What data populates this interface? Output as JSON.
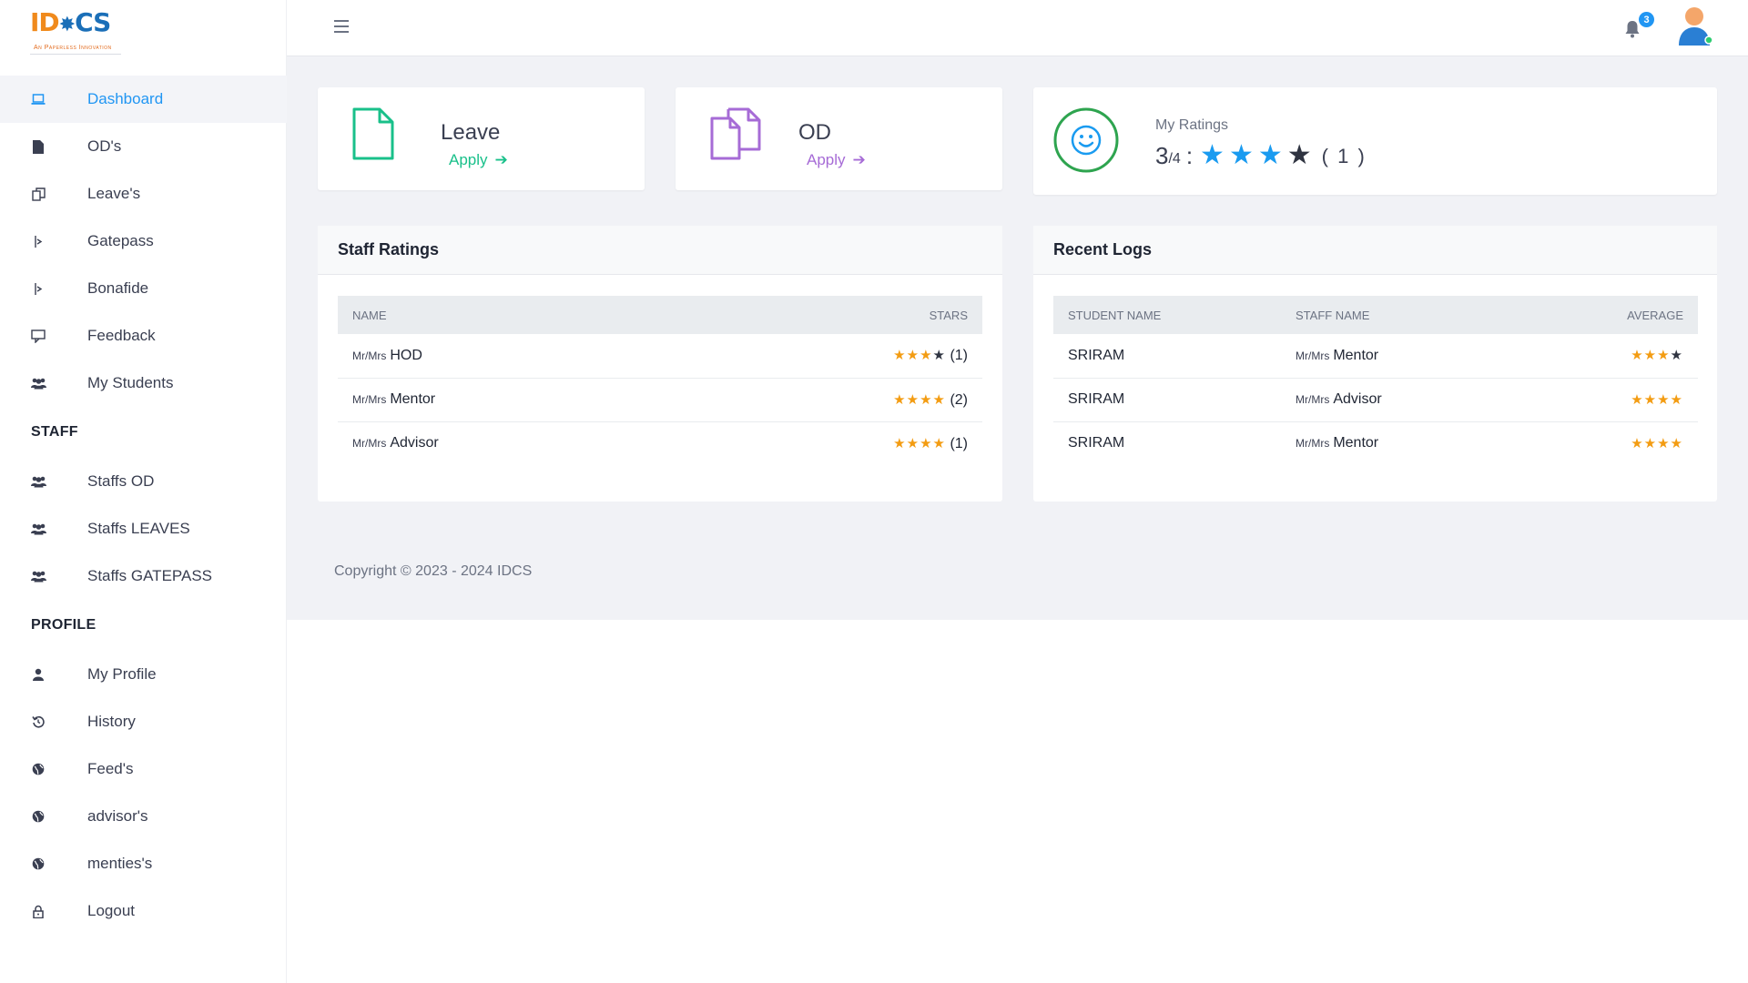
{
  "brand": {
    "logo_id": "ID",
    "logo_cs": "CS",
    "tagline": "An Paperless Innovation"
  },
  "colors": {
    "accent": "#2196f3",
    "leave": "#19c08a",
    "od": "#a66bd6",
    "star_orange": "#f39c12",
    "star_blue": "#1a9bf0",
    "ratings_ring": "#2ea44f"
  },
  "sidebar": {
    "main_items": [
      {
        "label": "Dashboard",
        "icon": "laptop-icon",
        "active": true
      },
      {
        "label": "OD's",
        "icon": "file-icon"
      },
      {
        "label": "Leave's",
        "icon": "copy-icon"
      },
      {
        "label": "Gatepass",
        "icon": "gate-icon"
      },
      {
        "label": "Bonafide",
        "icon": "gate-icon"
      },
      {
        "label": "Feedback",
        "icon": "comment-icon"
      },
      {
        "label": "My Students",
        "icon": "users-icon"
      }
    ],
    "staff_heading": "STAFF",
    "staff_items": [
      {
        "label": "Staffs OD",
        "icon": "users-icon"
      },
      {
        "label": "Staffs LEAVES",
        "icon": "users-icon"
      },
      {
        "label": "Staffs GATEPASS",
        "icon": "users-icon"
      }
    ],
    "profile_heading": "PROFILE",
    "profile_items": [
      {
        "label": "My Profile",
        "icon": "user-icon"
      },
      {
        "label": "History",
        "icon": "history-icon"
      },
      {
        "label": "Feed's",
        "icon": "globe-icon"
      },
      {
        "label": "advisor's",
        "icon": "globe-icon"
      },
      {
        "label": "menties's",
        "icon": "globe-icon"
      },
      {
        "label": "Logout",
        "icon": "lock-icon"
      }
    ]
  },
  "topbar": {
    "notification_count": "3"
  },
  "cards": {
    "leave": {
      "title": "Leave",
      "link": "Apply"
    },
    "od": {
      "title": "OD",
      "link": "Apply"
    },
    "ratings": {
      "label": "My Ratings",
      "score": "3",
      "denominator": "/4",
      "colon": ":",
      "filled_stars": 3,
      "total_stars": 4,
      "count": "( 1 )"
    }
  },
  "staff_ratings": {
    "title": "Staff Ratings",
    "columns": [
      "NAME",
      "STARS"
    ],
    "rows": [
      {
        "prefix": "Mr/Mrs",
        "name": "HOD",
        "filled": 3,
        "total": 4,
        "count": "(1)"
      },
      {
        "prefix": "Mr/Mrs",
        "name": "Mentor",
        "filled": 4,
        "total": 4,
        "count": "(2)"
      },
      {
        "prefix": "Mr/Mrs",
        "name": "Advisor",
        "filled": 4,
        "total": 4,
        "count": "(1)"
      }
    ]
  },
  "recent_logs": {
    "title": "Recent Logs",
    "columns": [
      "STUDENT NAME",
      "STAFF NAME",
      "AVERAGE"
    ],
    "rows": [
      {
        "student": "SRIRAM",
        "prefix": "Mr/Mrs",
        "staff": "Mentor",
        "filled": 3,
        "total": 4
      },
      {
        "student": "SRIRAM",
        "prefix": "Mr/Mrs",
        "staff": "Advisor",
        "filled": 4,
        "total": 4
      },
      {
        "student": "SRIRAM",
        "prefix": "Mr/Mrs",
        "staff": "Mentor",
        "filled": 4,
        "total": 4
      }
    ]
  },
  "footer": {
    "copyright": "Copyright © 2023 - 2024 IDCS"
  }
}
